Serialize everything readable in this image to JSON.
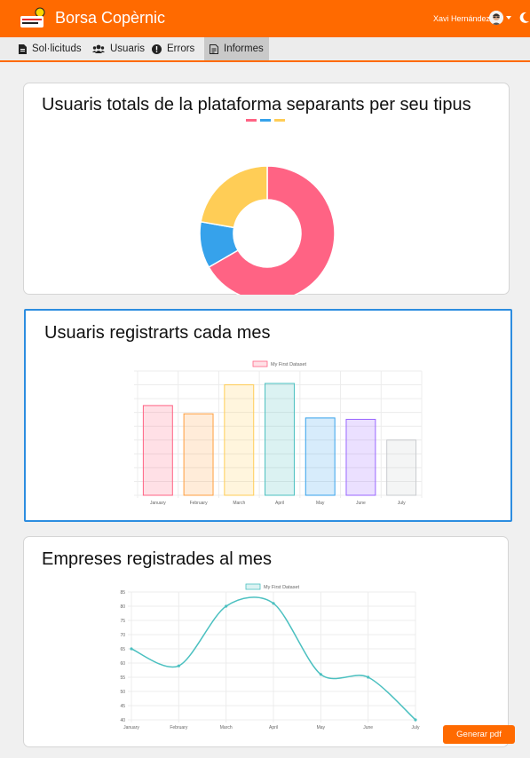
{
  "header": {
    "app_title": "Borsa Copèrnic",
    "user_name": "Xavi Hernández",
    "colors": {
      "brand": "#ff6a00",
      "selected": "#2d8de0"
    }
  },
  "nav": {
    "items": [
      {
        "label": "Sol·licituds",
        "icon": "document-icon"
      },
      {
        "label": "Usuaris",
        "icon": "users-icon"
      },
      {
        "label": "Errors",
        "icon": "exclamation-circle-icon"
      },
      {
        "label": "Informes",
        "icon": "report-icon",
        "active": true
      }
    ]
  },
  "cards": {
    "users_type_title": "Usuaris totals de la plataforma separants per seu tipus",
    "users_month_title": "Usuaris registrarts cada mes",
    "companies_month_title": "Empreses registrades al mes"
  },
  "generate_button": "Generar pdf",
  "chart_data": [
    {
      "type": "pie",
      "variant": "doughnut",
      "labels": [
        "",
        "",
        ""
      ],
      "values": [
        300,
        50,
        100
      ],
      "colors": [
        "#ff6384",
        "#36a2eb",
        "#ffcd56"
      ],
      "legend": "top"
    },
    {
      "type": "bar",
      "categories": [
        "January",
        "February",
        "March",
        "April",
        "May",
        "June",
        "July"
      ],
      "series": [
        {
          "name": "My First Dataset",
          "values": [
            65,
            59,
            80,
            81,
            56,
            55,
            40
          ]
        }
      ],
      "colors": [
        "#ff6384",
        "#ff9f40",
        "#ffcd56",
        "#4bc0c0",
        "#36a2eb",
        "#9966ff",
        "#c9cbcf"
      ],
      "ylim": [
        0,
        90
      ],
      "legend": "top"
    },
    {
      "type": "line",
      "categories": [
        "January",
        "February",
        "March",
        "April",
        "May",
        "June",
        "July"
      ],
      "series": [
        {
          "name": "My First Dataset",
          "values": [
            65,
            59,
            80,
            81,
            56,
            55,
            40
          ]
        }
      ],
      "color": "#4bc0c0",
      "ylim": [
        40,
        85
      ],
      "yticks": [
        85,
        80,
        75,
        70,
        65,
        60,
        55,
        50,
        45,
        40
      ],
      "grid": true,
      "legend": "top"
    }
  ]
}
